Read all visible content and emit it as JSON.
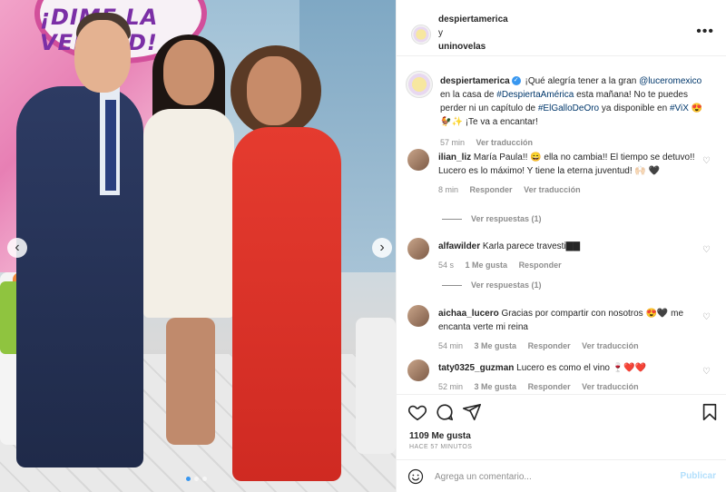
{
  "post": {
    "author": "despiertamerica",
    "collaborator_joiner": "y",
    "collaborator": "uninovelas",
    "more_icon": "more-horizontal-icon"
  },
  "caption": {
    "author": "despiertamerica",
    "text_1": "¡Qué alegría tener a la gran",
    "mention": "@luceromexico",
    "text_2": "en la casa de",
    "hashtag_1": "#DespiertaAmérica",
    "text_3": "esta mañana! No te puedes perder ni un capítulo de",
    "hashtag_2": "#ElGalloDeOro",
    "text_4": "ya disponible en",
    "hashtag_3": "#ViX",
    "emojis": "😍🐓✨",
    "text_5": "¡Te va a encantar!",
    "time": "57 min",
    "translate": "Ver traducción"
  },
  "comments": [
    {
      "user": "ilian_liz",
      "text": "María Paula!! 😄 ella no cambia!! El tiempo se detuvo!! Lucero es lo máximo! Y tiene la eterna juventud! 🙌🏻 🖤",
      "time": "8 min",
      "reply": "Responder",
      "translate": "Ver traducción",
      "view_replies": "Ver respuestas (1)"
    },
    {
      "user": "alfawilder",
      "text": "Karla parece travesti▇▇",
      "time": "54 s",
      "likes": "1 Me gusta",
      "reply": "Responder",
      "view_replies": "Ver respuestas (1)"
    },
    {
      "user": "aichaa_lucero",
      "text": "Gracias por compartir con nosotros 😍🖤 me encanta verte mi reina",
      "time": "54 min",
      "likes": "3 Me gusta",
      "reply": "Responder",
      "translate": "Ver traducción"
    },
    {
      "user": "taty0325_guzman",
      "text": "Lucero es como el vino 🍷❤️❤️",
      "time": "52 min",
      "likes": "3 Me gusta",
      "reply": "Responder",
      "translate": "Ver traducción"
    }
  ],
  "actions": {
    "likes": "1109 Me gusta",
    "posted_ago": "HACE 57 MINUTOS"
  },
  "composer": {
    "placeholder": "Agrega un comentario...",
    "post_label": "Publicar"
  },
  "photo": {
    "sign_text": "¡DIME LA VERDAD!",
    "prev_icon": "chevron-left-icon",
    "next_icon": "chevron-right-icon"
  },
  "colors": {
    "link": "#00376b",
    "verified": "#3897f0",
    "muted": "#8e8e8e",
    "post_disabled": "#b2dffc"
  }
}
